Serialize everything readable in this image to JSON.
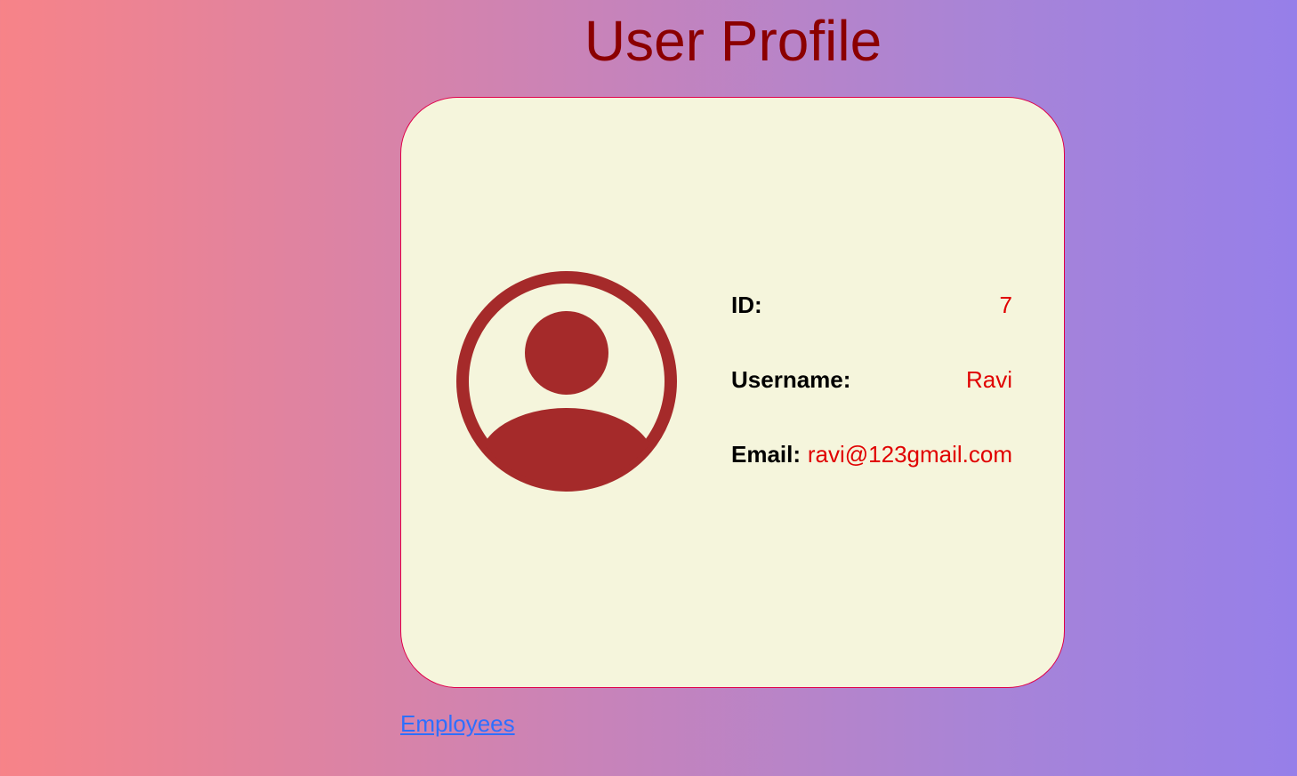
{
  "page": {
    "title": "User Profile"
  },
  "profile": {
    "avatar_icon": "user-circle-icon",
    "fields": [
      {
        "label": "ID:",
        "value": "7"
      },
      {
        "label": "Username:",
        "value": "Ravi"
      },
      {
        "label": "Email:",
        "value": "ravi@123gmail.com"
      }
    ]
  },
  "links": {
    "employees": "Employees"
  },
  "colors": {
    "title": "#8b0000",
    "card_background": "#f5f5dc",
    "card_border": "#e0004a",
    "avatar": "#a52a2a",
    "label": "#000000",
    "value": "#e00000",
    "link": "#2e6fff",
    "gradient_start": "#f78388",
    "gradient_end": "#967fe9"
  }
}
